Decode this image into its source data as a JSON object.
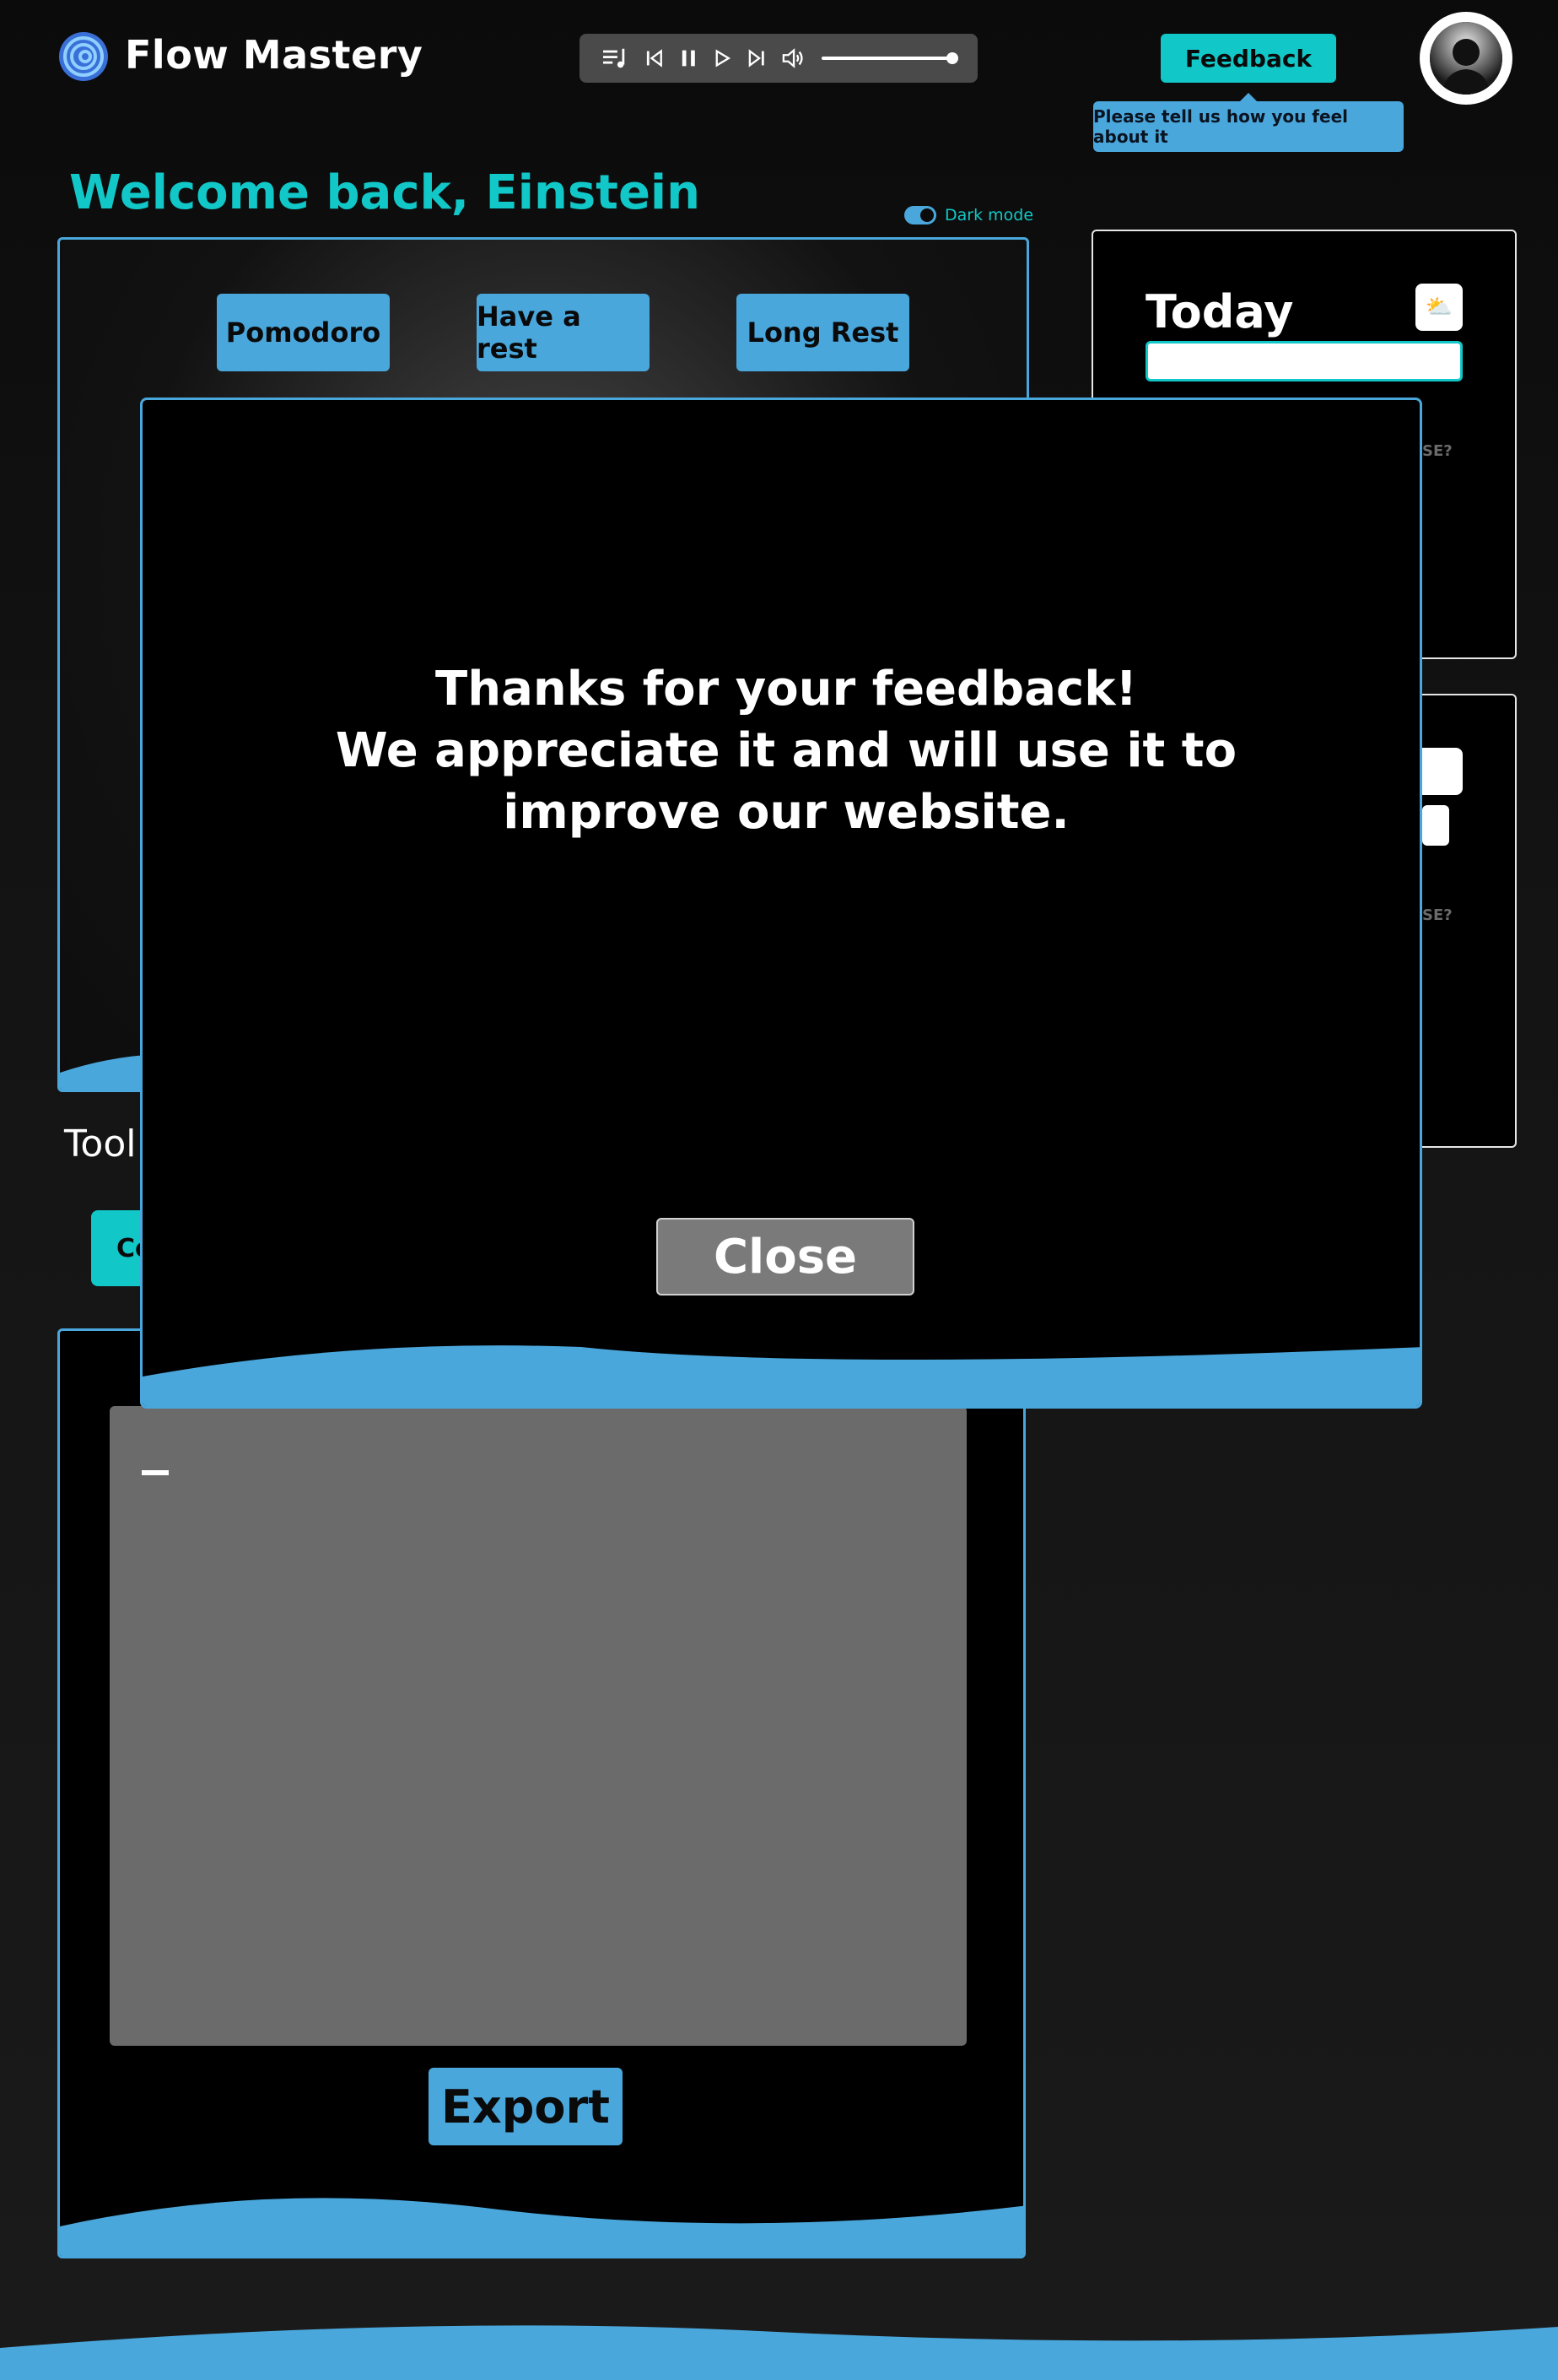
{
  "app": {
    "brand": "Flow Mastery"
  },
  "header": {
    "feedback_label": "Feedback",
    "tooltip_text": "Please tell us how you feel about it"
  },
  "welcome": {
    "title": "Welcome back, Einstein",
    "dark_mode_label": "Dark mode"
  },
  "timer": {
    "modes": [
      "Pomodoro",
      "Have a rest",
      "Long Rest"
    ]
  },
  "tools": {
    "label": "Tool",
    "partial_button": "Co"
  },
  "today_card": {
    "title": "Today",
    "hint_partial": "SE?"
  },
  "second_card": {
    "hint_partial": "SE?"
  },
  "notes": {
    "export_label": "Export"
  },
  "modal": {
    "line1": "Thanks for your feedback!",
    "line2": "We appreciate it and will use it to improve our website.",
    "close_label": "Close"
  },
  "colors": {
    "accent_blue": "#4aa7dc",
    "accent_teal": "#12c7c7",
    "background": "#0b0b0b"
  },
  "icons": [
    "logo-spiral-icon",
    "playlist-icon",
    "previous-icon",
    "pause-icon",
    "play-icon",
    "next-icon",
    "volume-icon",
    "avatar-silhouette-icon",
    "weather-icon",
    "emoji-icon"
  ]
}
